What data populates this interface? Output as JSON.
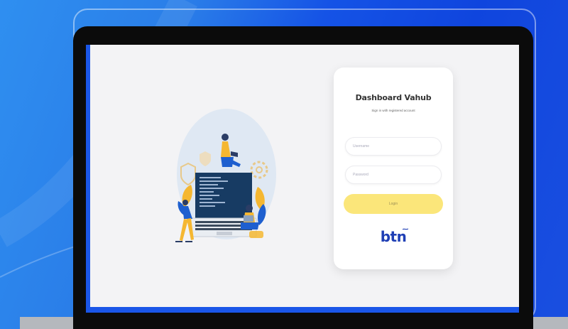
{
  "login": {
    "title": "Dashboard Vahub",
    "subtitle": "Sign in with registered account",
    "username_placeholder": "Username",
    "password_placeholder": "Password",
    "login_label": "Login"
  },
  "logo": {
    "text": "btn"
  },
  "colors": {
    "background_blue": "#1553e6",
    "login_button": "#fbe67a",
    "logo_blue": "#1f3fb5",
    "illustration_yellow": "#f5b731",
    "illustration_blue": "#1e5fcf"
  },
  "icons": [
    "laptop-illustration",
    "person-illustration",
    "shield-icon",
    "gear-icon"
  ]
}
